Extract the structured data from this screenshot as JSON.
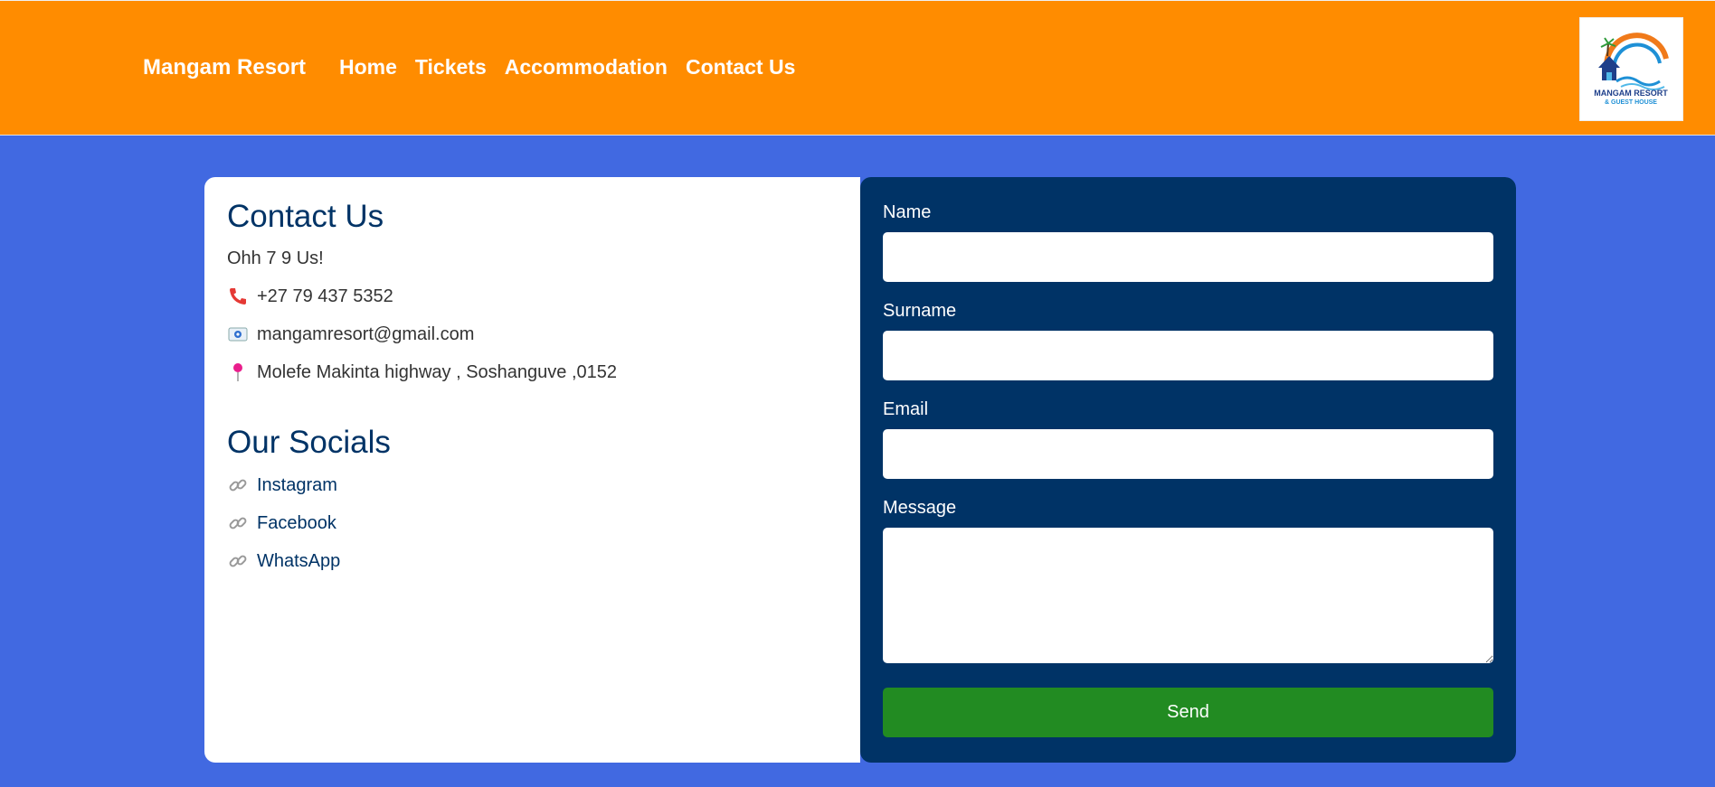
{
  "header": {
    "brand": "Mangam Resort",
    "nav": [
      "Home",
      "Tickets",
      "Accommodation",
      "Contact Us"
    ],
    "logo_text_line1": "MANGAM RESORT",
    "logo_text_line2": "& GUEST HOUSE"
  },
  "contact": {
    "title": "Contact Us",
    "tagline": "Ohh 7 9 Us!",
    "phone": "+27 79 437 5352",
    "email": "mangamresort@gmail.com",
    "address": "Molefe Makinta highway , Soshanguve ,0152"
  },
  "socials": {
    "title": "Our Socials",
    "links": [
      "Instagram",
      "Facebook",
      "WhatsApp"
    ]
  },
  "form": {
    "name_label": "Name",
    "surname_label": "Surname",
    "email_label": "Email",
    "message_label": "Message",
    "send_label": "Send"
  },
  "colors": {
    "header_bg": "#ff8c00",
    "page_bg": "#4169e1",
    "form_bg": "#003366",
    "send_bg": "#228b22"
  },
  "icons": {
    "phone": "phone-icon",
    "email": "envelope-icon",
    "address": "pin-icon",
    "social": "link-icon"
  }
}
